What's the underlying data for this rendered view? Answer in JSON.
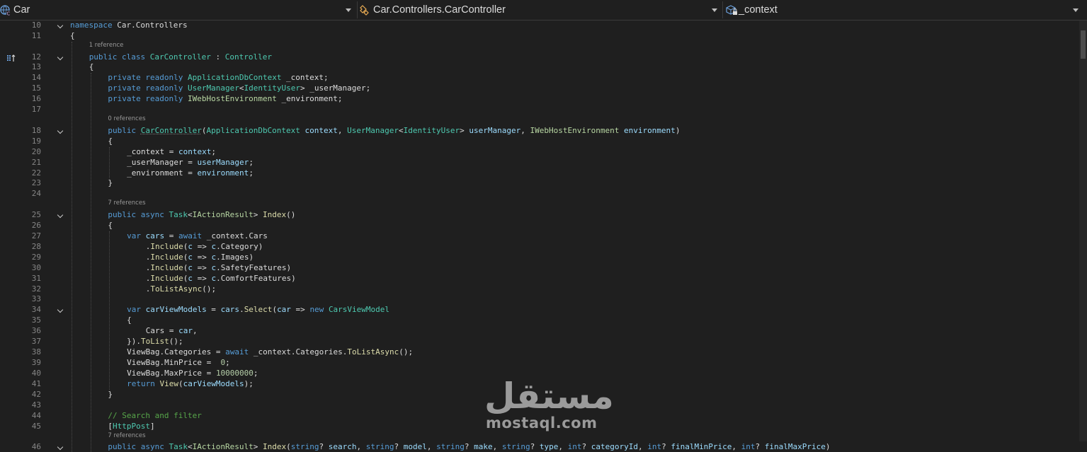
{
  "navbar": {
    "project": "Car",
    "type": "Car.Controllers.CarController",
    "member": "_context"
  },
  "code_lines": [
    {
      "n": "10",
      "fold": true,
      "indent": 0,
      "segs": [
        [
          "kw",
          "namespace "
        ],
        [
          "pl",
          "Car.Controllers"
        ]
      ]
    },
    {
      "n": "11",
      "indent": 0,
      "segs": [
        [
          "pl",
          "{"
        ]
      ]
    },
    {
      "lens": "1 reference",
      "lensIndent": 1
    },
    {
      "n": "12",
      "fold": true,
      "indent": 1,
      "segs": [
        [
          "kw",
          "public "
        ],
        [
          "kw",
          "class "
        ],
        [
          "ty",
          "CarController"
        ],
        [
          "pl",
          " : "
        ],
        [
          "ty",
          "Controller"
        ]
      ]
    },
    {
      "n": "13",
      "indent": 1,
      "segs": [
        [
          "pl",
          "{"
        ]
      ]
    },
    {
      "n": "14",
      "indent": 2,
      "segs": [
        [
          "kw",
          "private "
        ],
        [
          "kw",
          "readonly "
        ],
        [
          "ty",
          "ApplicationDbContext"
        ],
        [
          "pl",
          " _context;"
        ]
      ]
    },
    {
      "n": "15",
      "indent": 2,
      "segs": [
        [
          "kw",
          "private "
        ],
        [
          "kw",
          "readonly "
        ],
        [
          "ty",
          "UserManager"
        ],
        [
          "pl",
          "<"
        ],
        [
          "ty",
          "IdentityUser"
        ],
        [
          "pl",
          "> _userManager;"
        ]
      ]
    },
    {
      "n": "16",
      "indent": 2,
      "segs": [
        [
          "kw",
          "private "
        ],
        [
          "kw",
          "readonly "
        ],
        [
          "it",
          "IWebHostEnvironment"
        ],
        [
          "pl",
          " _environment;"
        ]
      ]
    },
    {
      "n": "17",
      "indent": 2,
      "segs": []
    },
    {
      "lens": "0 references",
      "lensIndent": 2
    },
    {
      "n": "18",
      "fold": true,
      "indent": 2,
      "segs": [
        [
          "kw",
          "public "
        ],
        [
          "ty ul",
          "CarController"
        ],
        [
          "pl",
          "("
        ],
        [
          "ty",
          "ApplicationDbContext"
        ],
        [
          "pa",
          " context"
        ],
        [
          "pl",
          ", "
        ],
        [
          "ty",
          "UserManager"
        ],
        [
          "pl",
          "<"
        ],
        [
          "ty",
          "IdentityUser"
        ],
        [
          "pl",
          "> "
        ],
        [
          "pa",
          "userManager"
        ],
        [
          "pl",
          ", "
        ],
        [
          "it",
          "IWebHostEnvironment"
        ],
        [
          "pa",
          " environment"
        ],
        [
          "pl",
          ")"
        ]
      ]
    },
    {
      "n": "19",
      "indent": 2,
      "segs": [
        [
          "pl",
          "{"
        ]
      ]
    },
    {
      "n": "20",
      "indent": 3,
      "segs": [
        [
          "fld",
          "_context"
        ],
        [
          "pl",
          " = "
        ],
        [
          "pa",
          "context"
        ],
        [
          "pl",
          ";"
        ]
      ]
    },
    {
      "n": "21",
      "indent": 3,
      "segs": [
        [
          "fld",
          "_userManager"
        ],
        [
          "pl",
          " = "
        ],
        [
          "pa",
          "userManager"
        ],
        [
          "pl",
          ";"
        ]
      ]
    },
    {
      "n": "22",
      "indent": 3,
      "segs": [
        [
          "fld",
          "_environment"
        ],
        [
          "pl",
          " = "
        ],
        [
          "pa",
          "environment"
        ],
        [
          "pl",
          ";"
        ]
      ]
    },
    {
      "n": "23",
      "indent": 2,
      "segs": [
        [
          "pl",
          "}"
        ]
      ]
    },
    {
      "n": "24",
      "indent": 2,
      "segs": []
    },
    {
      "lens": "7 references",
      "lensIndent": 2
    },
    {
      "n": "25",
      "fold": true,
      "indent": 2,
      "segs": [
        [
          "kw",
          "public "
        ],
        [
          "kw",
          "async "
        ],
        [
          "ty",
          "Task"
        ],
        [
          "pl",
          "<"
        ],
        [
          "it",
          "IActionResult"
        ],
        [
          "pl",
          "> "
        ],
        [
          "mt",
          "Index"
        ],
        [
          "pl",
          "()"
        ]
      ]
    },
    {
      "n": "26",
      "indent": 2,
      "segs": [
        [
          "pl",
          "{"
        ]
      ]
    },
    {
      "n": "27",
      "indent": 3,
      "segs": [
        [
          "kw",
          "var "
        ],
        [
          "pa",
          "cars"
        ],
        [
          "pl",
          " = "
        ],
        [
          "kw",
          "await "
        ],
        [
          "fld",
          "_context"
        ],
        [
          "pl",
          ".Cars"
        ]
      ]
    },
    {
      "n": "28",
      "indent": 4,
      "segs": [
        [
          "pl",
          "."
        ],
        [
          "mt",
          "Include"
        ],
        [
          "pl",
          "("
        ],
        [
          "pa",
          "c"
        ],
        [
          "pl",
          " => "
        ],
        [
          "pa",
          "c"
        ],
        [
          "pl",
          ".Category)"
        ]
      ]
    },
    {
      "n": "29",
      "indent": 4,
      "segs": [
        [
          "pl",
          "."
        ],
        [
          "mt",
          "Include"
        ],
        [
          "pl",
          "("
        ],
        [
          "pa",
          "c"
        ],
        [
          "pl",
          " => "
        ],
        [
          "pa",
          "c"
        ],
        [
          "pl",
          ".Images)"
        ]
      ]
    },
    {
      "n": "30",
      "indent": 4,
      "segs": [
        [
          "pl",
          "."
        ],
        [
          "mt",
          "Include"
        ],
        [
          "pl",
          "("
        ],
        [
          "pa",
          "c"
        ],
        [
          "pl",
          " => "
        ],
        [
          "pa",
          "c"
        ],
        [
          "pl",
          ".SafetyFeatures)"
        ]
      ]
    },
    {
      "n": "31",
      "indent": 4,
      "segs": [
        [
          "pl",
          "."
        ],
        [
          "mt",
          "Include"
        ],
        [
          "pl",
          "("
        ],
        [
          "pa",
          "c"
        ],
        [
          "pl",
          " => "
        ],
        [
          "pa",
          "c"
        ],
        [
          "pl",
          ".ComfortFeatures)"
        ]
      ]
    },
    {
      "n": "32",
      "indent": 4,
      "segs": [
        [
          "pl",
          "."
        ],
        [
          "mt",
          "ToListAsync"
        ],
        [
          "pl",
          "();"
        ]
      ]
    },
    {
      "n": "33",
      "indent": 3,
      "segs": []
    },
    {
      "n": "34",
      "fold": true,
      "indent": 3,
      "segs": [
        [
          "kw",
          "var "
        ],
        [
          "pa",
          "carViewModels"
        ],
        [
          "pl",
          " = "
        ],
        [
          "pa",
          "cars"
        ],
        [
          "pl",
          "."
        ],
        [
          "mt",
          "Select"
        ],
        [
          "pl",
          "("
        ],
        [
          "pa",
          "car"
        ],
        [
          "pl",
          " => "
        ],
        [
          "kw",
          "new "
        ],
        [
          "ty",
          "CarsViewModel"
        ]
      ]
    },
    {
      "n": "35",
      "indent": 3,
      "segs": [
        [
          "pl",
          "{"
        ]
      ]
    },
    {
      "n": "36",
      "indent": 4,
      "segs": [
        [
          "pl",
          "Cars = "
        ],
        [
          "pa",
          "car"
        ],
        [
          "pl",
          ","
        ]
      ]
    },
    {
      "n": "37",
      "indent": 3,
      "segs": [
        [
          "pl",
          "})."
        ],
        [
          "mt",
          "ToList"
        ],
        [
          "pl",
          "();"
        ]
      ]
    },
    {
      "n": "38",
      "indent": 3,
      "segs": [
        [
          "pl",
          "ViewBag.Categories = "
        ],
        [
          "kw",
          "await "
        ],
        [
          "fld",
          "_context"
        ],
        [
          "pl",
          ".Categories."
        ],
        [
          "mt",
          "ToListAsync"
        ],
        [
          "pl",
          "();"
        ]
      ]
    },
    {
      "n": "39",
      "indent": 3,
      "segs": [
        [
          "pl",
          "ViewBag.MinPrice =  "
        ],
        [
          "nm",
          "0"
        ],
        [
          "pl",
          ";"
        ]
      ]
    },
    {
      "n": "40",
      "indent": 3,
      "segs": [
        [
          "pl",
          "ViewBag.MaxPrice = "
        ],
        [
          "nm",
          "10000000"
        ],
        [
          "pl",
          ";"
        ]
      ]
    },
    {
      "n": "41",
      "indent": 3,
      "segs": [
        [
          "kw",
          "return "
        ],
        [
          "mt",
          "View"
        ],
        [
          "pl",
          "("
        ],
        [
          "pa",
          "carViewModels"
        ],
        [
          "pl",
          ");"
        ]
      ]
    },
    {
      "n": "42",
      "indent": 2,
      "segs": [
        [
          "pl",
          "}"
        ]
      ]
    },
    {
      "n": "43",
      "indent": 2,
      "segs": []
    },
    {
      "n": "44",
      "indent": 2,
      "segs": [
        [
          "cm",
          "// Search and filter"
        ]
      ]
    },
    {
      "n": "45",
      "indent": 2,
      "segs": [
        [
          "pl",
          "["
        ],
        [
          "at",
          "HttpPost"
        ],
        [
          "pl",
          "]"
        ]
      ]
    },
    {
      "lens": "7 references",
      "lensIndent": 2
    },
    {
      "n": "46",
      "fold": true,
      "indent": 2,
      "segs": [
        [
          "kw",
          "public "
        ],
        [
          "kw",
          "async "
        ],
        [
          "ty",
          "Task"
        ],
        [
          "pl",
          "<"
        ],
        [
          "it",
          "IActionResult"
        ],
        [
          "pl",
          "> "
        ],
        [
          "mt",
          "Index"
        ],
        [
          "pl",
          "("
        ],
        [
          "kw",
          "string"
        ],
        [
          "pl",
          "? "
        ],
        [
          "pa",
          "search"
        ],
        [
          "pl",
          ", "
        ],
        [
          "kw",
          "string"
        ],
        [
          "pl",
          "? "
        ],
        [
          "pa",
          "model"
        ],
        [
          "pl",
          ", "
        ],
        [
          "kw",
          "string"
        ],
        [
          "pl",
          "? "
        ],
        [
          "pa",
          "make"
        ],
        [
          "pl",
          ", "
        ],
        [
          "kw",
          "string"
        ],
        [
          "pl",
          "? "
        ],
        [
          "pa",
          "type"
        ],
        [
          "pl",
          ", "
        ],
        [
          "kw",
          "int"
        ],
        [
          "pl",
          "? "
        ],
        [
          "pa",
          "categoryId"
        ],
        [
          "pl",
          ", "
        ],
        [
          "kw",
          "int"
        ],
        [
          "pl",
          "? "
        ],
        [
          "pa",
          "finalMinPrice"
        ],
        [
          "pl",
          ", "
        ],
        [
          "kw",
          "int"
        ],
        [
          "pl",
          "? "
        ],
        [
          "pa",
          "finalMaxPrice"
        ],
        [
          "pl",
          ")"
        ]
      ]
    }
  ],
  "watermark": {
    "arabic": "مستقل",
    "latin": "mostaql.com"
  },
  "colors": {
    "background": "#1f1f1f",
    "keyword": "#569cd6",
    "type": "#4ec9b0",
    "interface": "#b8d7a3",
    "method": "#dcdcaa",
    "param": "#9cdcfe",
    "number": "#b5cea8",
    "comment": "#57a64a"
  },
  "icons": {
    "project": "csharp-project-icon",
    "type": "class-icon",
    "member": "field-icon",
    "margin": "bookmark-icon"
  }
}
